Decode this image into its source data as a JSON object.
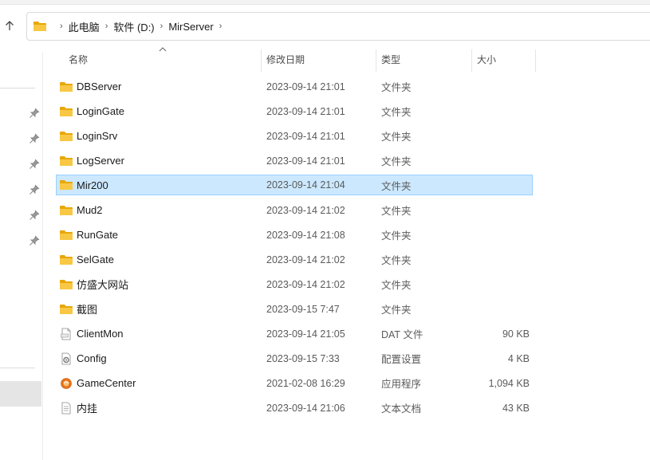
{
  "address": {
    "crumbs": [
      "此电脑",
      "软件 (D:)",
      "MirServer"
    ],
    "separator": "›"
  },
  "columns": {
    "name": "名称",
    "date": "修改日期",
    "type": "类型",
    "size": "大小"
  },
  "files": [
    {
      "name": "DBServer",
      "date": "2023-09-14 21:01",
      "type": "文件夹",
      "size": "",
      "icon": "folder-icon"
    },
    {
      "name": "LoginGate",
      "date": "2023-09-14 21:01",
      "type": "文件夹",
      "size": "",
      "icon": "folder-icon"
    },
    {
      "name": "LoginSrv",
      "date": "2023-09-14 21:01",
      "type": "文件夹",
      "size": "",
      "icon": "folder-icon"
    },
    {
      "name": "LogServer",
      "date": "2023-09-14 21:01",
      "type": "文件夹",
      "size": "",
      "icon": "folder-icon"
    },
    {
      "name": "Mir200",
      "date": "2023-09-14 21:04",
      "type": "文件夹",
      "size": "",
      "icon": "folder-icon",
      "selected": true
    },
    {
      "name": "Mud2",
      "date": "2023-09-14 21:02",
      "type": "文件夹",
      "size": "",
      "icon": "folder-icon"
    },
    {
      "name": "RunGate",
      "date": "2023-09-14 21:08",
      "type": "文件夹",
      "size": "",
      "icon": "folder-icon"
    },
    {
      "name": "SelGate",
      "date": "2023-09-14 21:02",
      "type": "文件夹",
      "size": "",
      "icon": "folder-icon"
    },
    {
      "name": "仿盛大网站",
      "date": "2023-09-14 21:02",
      "type": "文件夹",
      "size": "",
      "icon": "folder-icon"
    },
    {
      "name": "截图",
      "date": "2023-09-15 7:47",
      "type": "文件夹",
      "size": "",
      "icon": "folder-icon"
    },
    {
      "name": "ClientMon",
      "date": "2023-09-14 21:05",
      "type": "DAT 文件",
      "size": "90 KB",
      "icon": "dat-file-icon"
    },
    {
      "name": "Config",
      "date": "2023-09-15 7:33",
      "type": "配置设置",
      "size": "4 KB",
      "icon": "config-file-icon"
    },
    {
      "name": "GameCenter",
      "date": "2021-02-08 16:29",
      "type": "应用程序",
      "size": "1,094 KB",
      "icon": "app-icon"
    },
    {
      "name": "内挂",
      "date": "2023-09-14 21:06",
      "type": "文本文档",
      "size": "43 KB",
      "icon": "text-file-icon"
    }
  ],
  "colors": {
    "selection_bg": "#cce8ff",
    "selection_border": "#99d1ff",
    "folder": "#f6c343"
  }
}
